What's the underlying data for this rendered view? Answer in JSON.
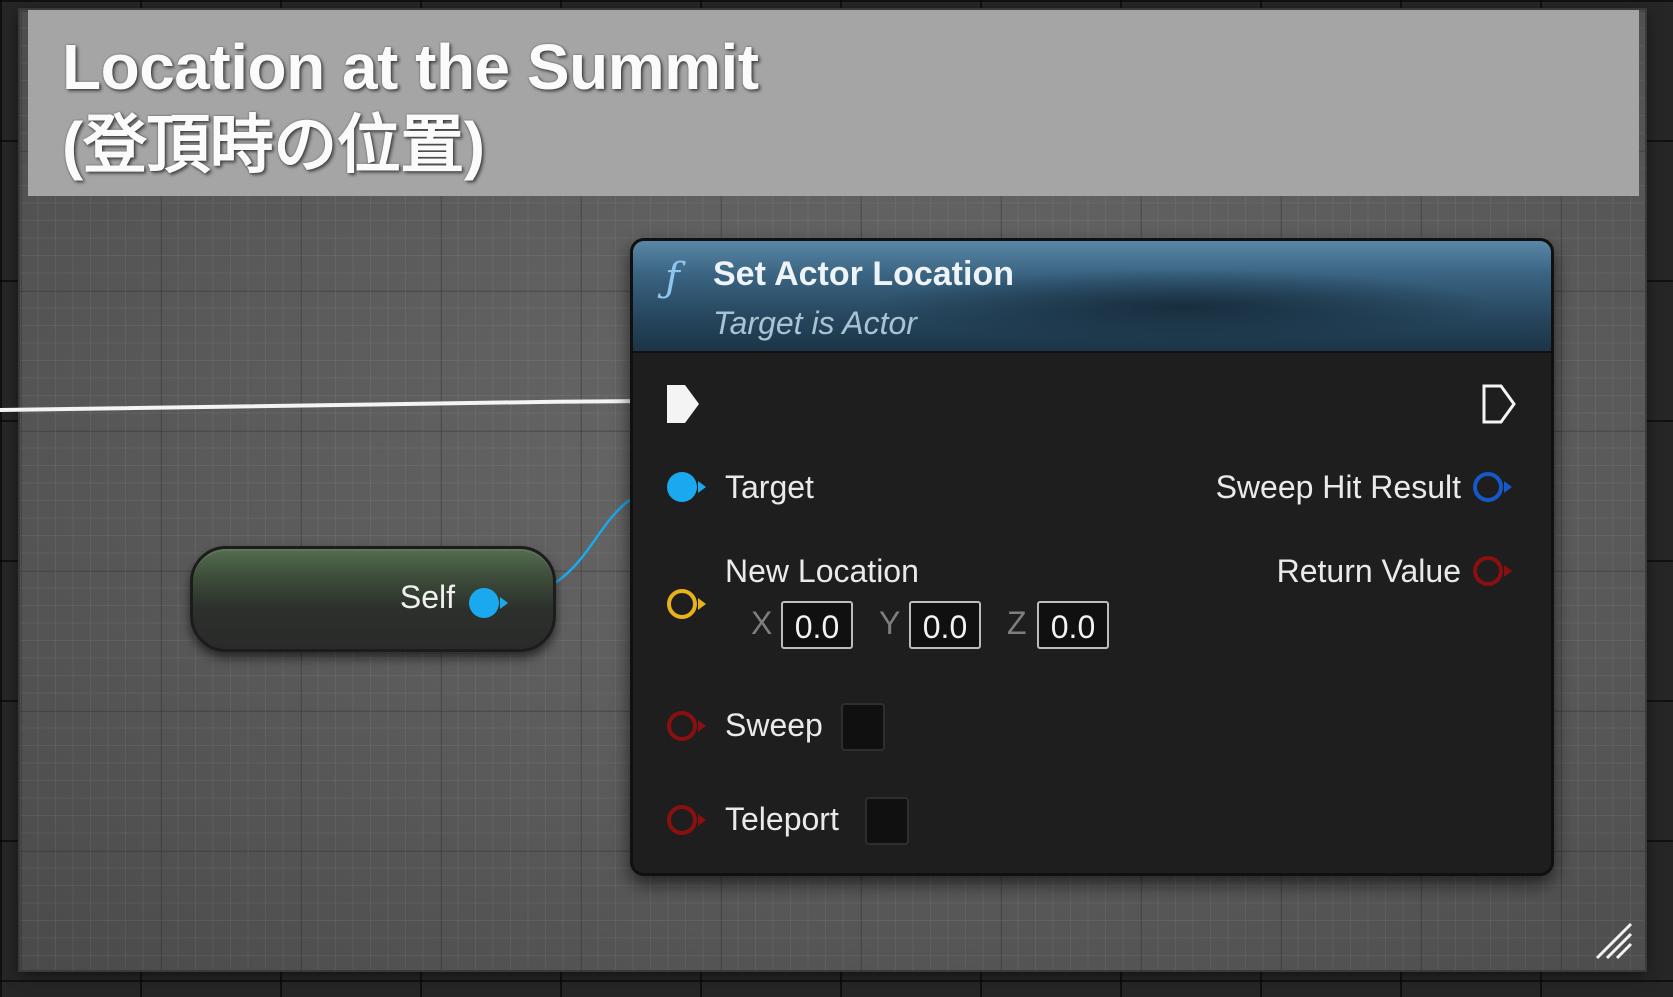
{
  "comment": {
    "title": "Location at the Summit\n(登頂時の位置)",
    "color": "#a5a5a5"
  },
  "self_node": {
    "label": "Self",
    "pin_icon": "object-pin-icon",
    "pin_color": "#1aa9ee"
  },
  "function_node": {
    "icon": "ƒ",
    "title": "Set Actor Location",
    "subtitle": "Target is Actor",
    "header_color": "#3a6482",
    "inputs": {
      "target": {
        "label": "Target",
        "color": "#1aa9ee"
      },
      "new_location": {
        "label": "New Location",
        "color": "#e8b21a",
        "x_label": "X",
        "x_value": "0.0",
        "y_label": "Y",
        "y_value": "0.0",
        "z_label": "Z",
        "z_value": "0.0"
      },
      "sweep": {
        "label": "Sweep",
        "color": "#8a1010"
      },
      "teleport": {
        "label": "Teleport",
        "color": "#8a1010"
      }
    },
    "outputs": {
      "sweep_hit_result": {
        "label": "Sweep Hit Result",
        "color": "#1558c8"
      },
      "return_value": {
        "label": "Return Value",
        "color": "#8a1010"
      }
    }
  }
}
